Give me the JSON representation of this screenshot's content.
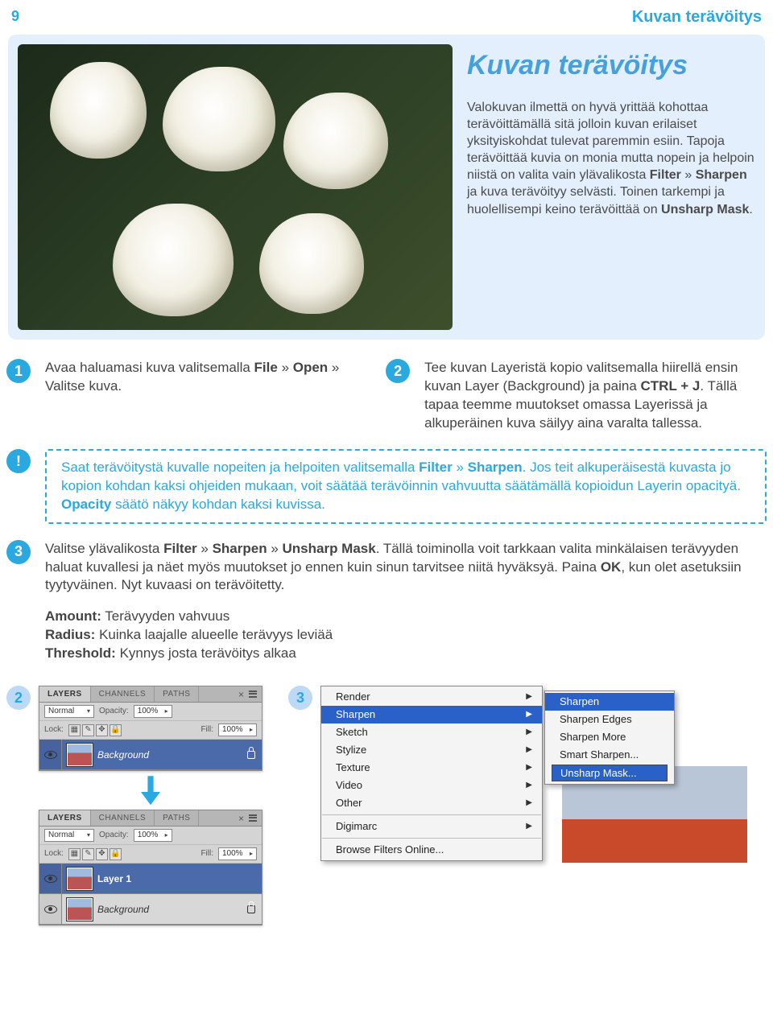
{
  "page": {
    "number": "9",
    "title": "Kuvan terävöitys"
  },
  "hero": {
    "title": "Kuvan terävöitys",
    "body_html": "Valokuvan ilmettä on hyvä yrittää kohottaa terävöittämällä sitä jolloin kuvan erilaiset yksityiskohdat tulevat paremmin esiin. Tapoja terävöittää kuvia on monia mutta nopein ja helpoin niistä on valita vain ylävalikosta <b>Filter</b> » <b>Sharpen</b> ja kuva terävöityy selvästi. Toinen tarkempi ja huolellisempi keino terävöittää on <b>Unsharp Mask</b>."
  },
  "steps": {
    "s1": {
      "num": "1",
      "body_html": "Avaa haluamasi kuva valitsemalla <b>File</b> » <b>Open</b> » Valitse kuva."
    },
    "s2": {
      "num": "2",
      "body_html": "Tee kuvan Layeristä kopio valitsemalla hiirellä ensin kuvan Layer (Background) ja paina <b>CTRL + J</b>. Tällä tapaa teemme muutokset omassa Layerissä ja alkuperäinen kuva säilyy aina varalta tallessa."
    },
    "tip": {
      "mark": "!",
      "body_html": "Saat terävöitystä kuvalle nopeiten ja helpoiten valitsemalla <b>Filter</b> » <b>Sharpen</b>. Jos teit alkuperäisestä kuvasta jo kopion kohdan kaksi ohjeiden mukaan, voit säätää terävöinnin vahvuutta säätämällä kopioidun Layerin opacityä. <b>Opacity</b> säätö näkyy kohdan kaksi kuvissa."
    },
    "s3": {
      "num": "3",
      "body_html": "Valitse ylävalikosta <b>Filter</b> » <b>Sharpen</b> » <b>Unsharp Mask</b>. Tällä toiminolla voit tarkkaan valita minkälaisen terävyyden haluat kuvallesi ja näet myös muutokset jo ennen kuin sinun tarvitsee niitä hyväksyä. Paina <b>OK</b>, kun olet asetuksiin tyytyväinen. Nyt kuvaasi on terävöitetty.",
      "props_html": "<b>Amount:</b> Terävyyden vahvuus<br><b>Radius:</b> Kuinka laajalle alueelle terävyys leviää<br><b>Threshold:</b> Kynnys josta terävöitys alkaa"
    }
  },
  "bottom": {
    "label2": "2",
    "label3": "3"
  },
  "panel": {
    "tabs": {
      "layers": "LAYERS",
      "channels": "CHANNELS",
      "paths": "PATHS"
    },
    "blend": "Normal",
    "opacity_label": "Opacity:",
    "opacity_value": "100%",
    "lock_label": "Lock:",
    "fill_label": "Fill:",
    "fill_value": "100%",
    "bg_layer": "Background",
    "layer1": "Layer 1"
  },
  "menu": {
    "render": "Render",
    "sharpen": "Sharpen",
    "sketch": "Sketch",
    "stylize": "Stylize",
    "texture": "Texture",
    "video": "Video",
    "other": "Other",
    "digimarc": "Digimarc",
    "browse": "Browse Filters Online...",
    "sub": {
      "sharpen": "Sharpen",
      "edges": "Sharpen Edges",
      "more": "Sharpen More",
      "smart": "Smart Sharpen...",
      "unsharp": "Unsharp Mask..."
    }
  }
}
